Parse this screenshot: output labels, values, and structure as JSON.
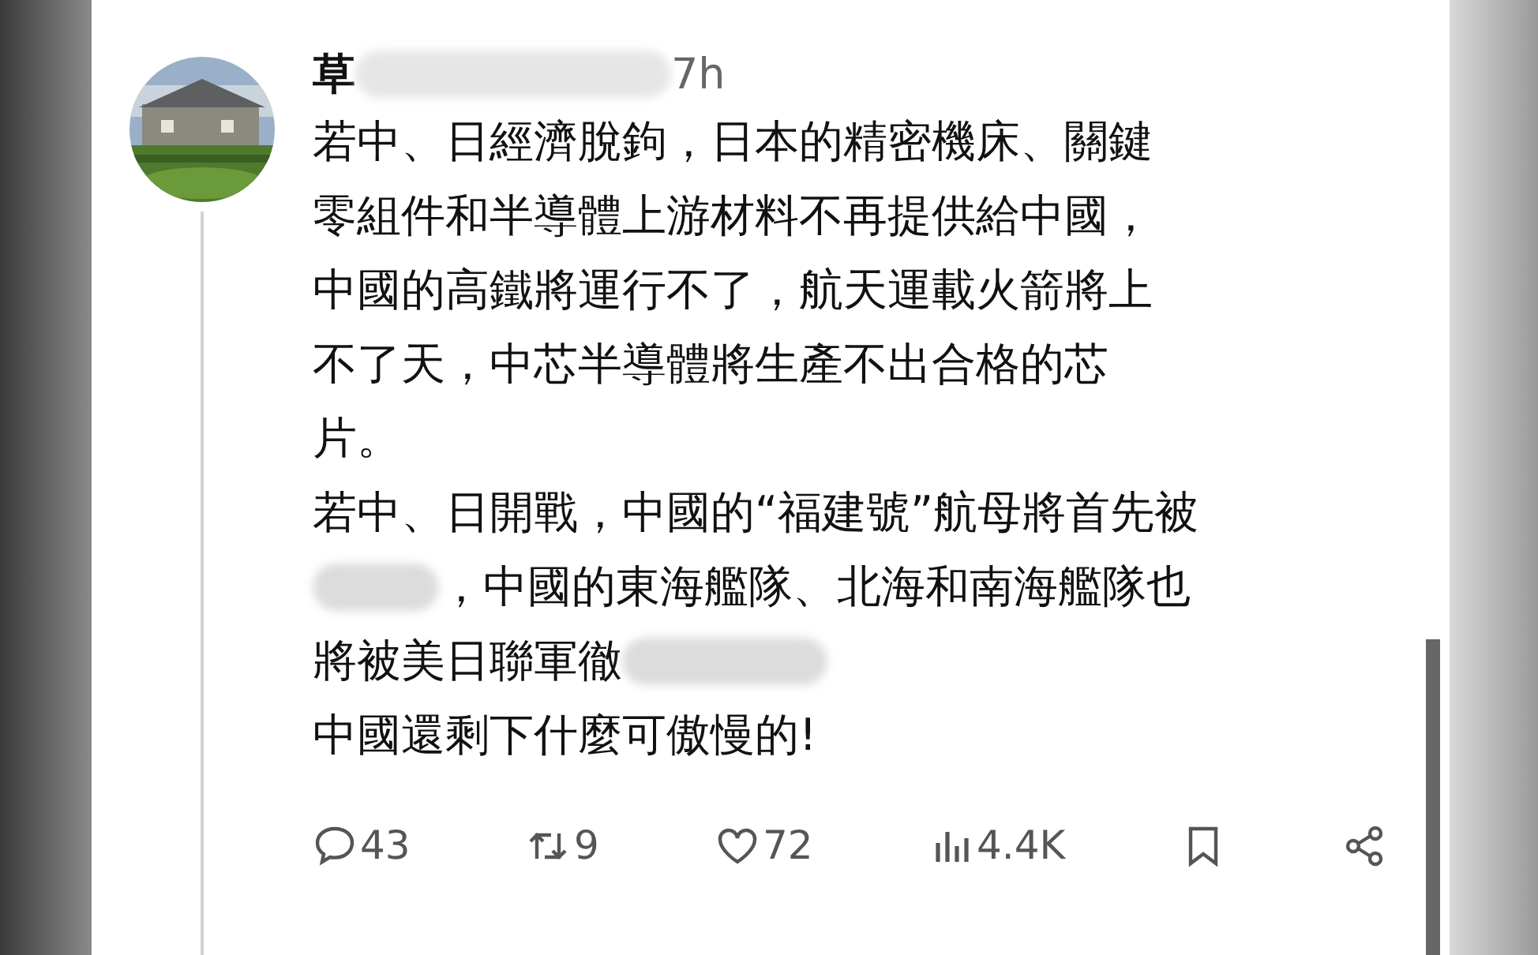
{
  "post": {
    "author": "草",
    "time": "7h",
    "paragraphs": [
      {
        "lines": [
          "若中、日經濟脫鉤，日本的精密機床、關鍵",
          "零組件和半導體上游材料不再提供給中國，",
          "中國的高鐵將運行不了，航天運載火箭將上",
          "不了天，中芯半導體將生產不出合格的芯",
          "片。"
        ]
      },
      {
        "lines": [
          "若中、日開戰，中國的“福建號”航母將首先被",
          "，中國的東海艦隊、北海和南海艦隊也",
          "將被美日聯軍徹",
          "中國還剩下什麼可傲慢的!"
        ]
      }
    ],
    "actions": [
      {
        "kind": "reply",
        "count": "43"
      },
      {
        "kind": "repost",
        "count": "9"
      },
      {
        "kind": "like",
        "count": "72"
      },
      {
        "kind": "views",
        "count": "4.4K"
      },
      {
        "kind": "bookmark"
      },
      {
        "kind": "share"
      }
    ]
  }
}
